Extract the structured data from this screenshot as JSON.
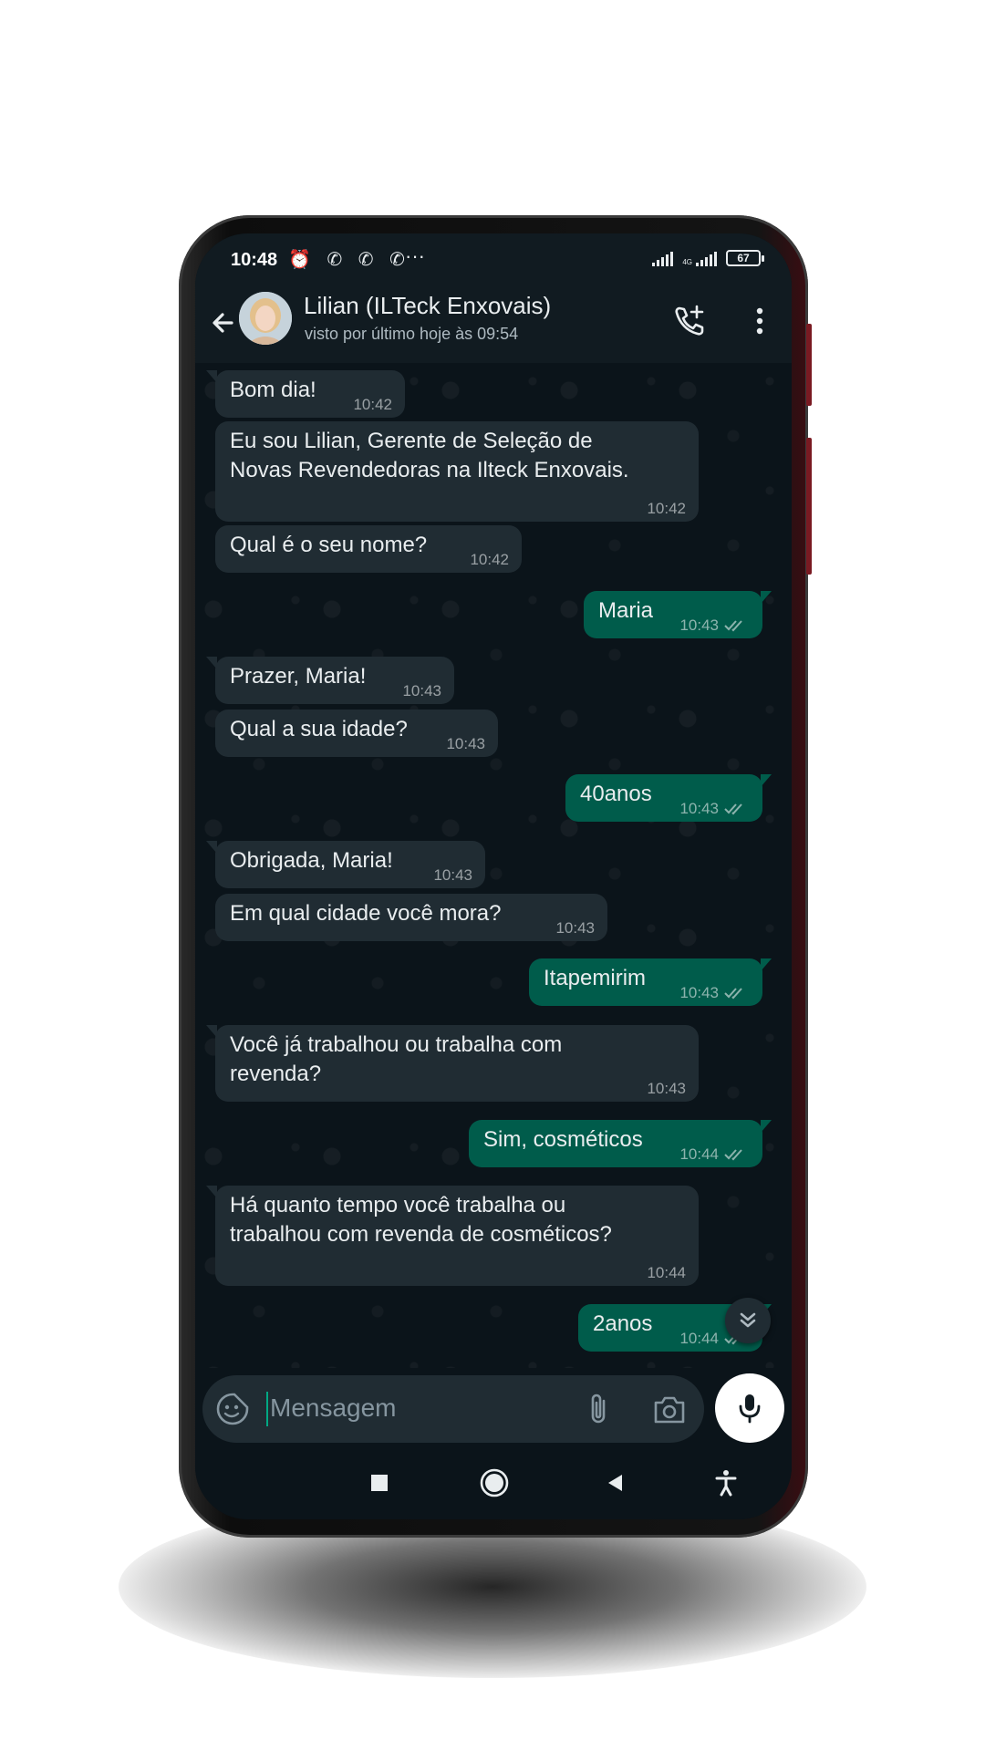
{
  "status_bar": {
    "time": "10:48",
    "notification_icons": "⏰ ✆ ✆ ✆",
    "more": "···",
    "network": "4G",
    "battery": "67"
  },
  "header": {
    "contact_name": "Lilian (ILTeck Enxovais)",
    "last_seen": "visto por último hoje às 09:54"
  },
  "messages": [
    {
      "dir": "in",
      "text": "Bom dia!",
      "time": "10:42"
    },
    {
      "dir": "in",
      "text": "Eu sou Lilian, Gerente de Seleção de",
      "text2": "Novas Revendedoras na Ilteck Enxovais.",
      "time": "10:42"
    },
    {
      "dir": "in",
      "text": "Qual é o seu nome?",
      "time": "10:42"
    },
    {
      "dir": "out",
      "text": "Maria",
      "time": "10:43"
    },
    {
      "dir": "in",
      "text": "Prazer, Maria!",
      "time": "10:43"
    },
    {
      "dir": "in",
      "text": "Qual a sua idade?",
      "time": "10:43"
    },
    {
      "dir": "out",
      "text": "40anos",
      "time": "10:43"
    },
    {
      "dir": "in",
      "text": "Obrigada, Maria!",
      "time": "10:43"
    },
    {
      "dir": "in",
      "text": "Em qual cidade você mora?",
      "time": "10:43"
    },
    {
      "dir": "out",
      "text": "Itapemirim",
      "time": "10:43"
    },
    {
      "dir": "in",
      "text": "Você já trabalhou ou trabalha com",
      "text2": "revenda?",
      "time": "10:43"
    },
    {
      "dir": "out",
      "text": "Sim, cosméticos",
      "time": "10:44"
    },
    {
      "dir": "in",
      "text": "Há quanto tempo você trabalha ou",
      "text2": "trabalhou com revenda de cosméticos?",
      "time": "10:44"
    },
    {
      "dir": "out",
      "text": "2anos",
      "time": "10:44"
    }
  ],
  "composer": {
    "placeholder": "Mensagem"
  },
  "icons": {
    "back": "arrow-left-icon",
    "call_add": "add-call-icon",
    "menu": "more-vert-icon",
    "sticker": "sticker-icon",
    "attach": "paperclip-icon",
    "camera": "camera-icon",
    "mic": "mic-icon",
    "scroll_down": "double-chevron-down-icon",
    "nav_recents": "square-icon",
    "nav_home": "circle-icon",
    "nav_back": "triangle-back-icon",
    "nav_accessibility": "accessibility-icon"
  },
  "colors": {
    "incoming_bubble": "#202c33",
    "outgoing_bubble": "#005c4b",
    "background": "#0b141a",
    "header": "#111b21"
  }
}
